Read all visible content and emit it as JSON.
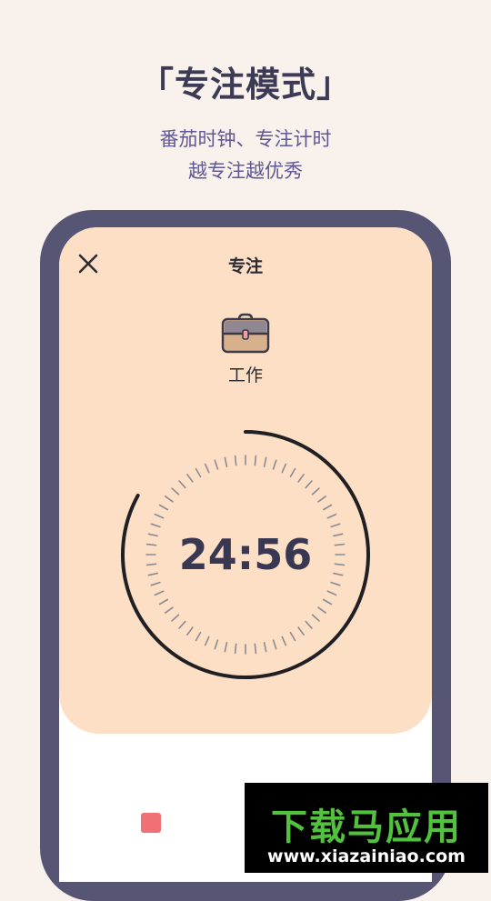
{
  "promo": {
    "headline": "「专注模式」",
    "subtitle_line1": "番茄时钟、专注计时",
    "subtitle_line2": "越专注越优秀"
  },
  "focus_screen": {
    "title": "专注",
    "close_icon": "close-icon",
    "task_icon": "briefcase-icon",
    "task_label": "工作",
    "timer_text": "24:56",
    "remaining_fraction": 0.83,
    "stop_icon": "stop-icon",
    "colors": {
      "panel": "#fcdfc5",
      "accent_stop": "#f07076",
      "frame": "#575574",
      "text_dark": "#393852"
    }
  },
  "watermark": {
    "brand": "下载马应用",
    "url": "www.xiazainiao.com",
    "color": "#52c23e"
  }
}
